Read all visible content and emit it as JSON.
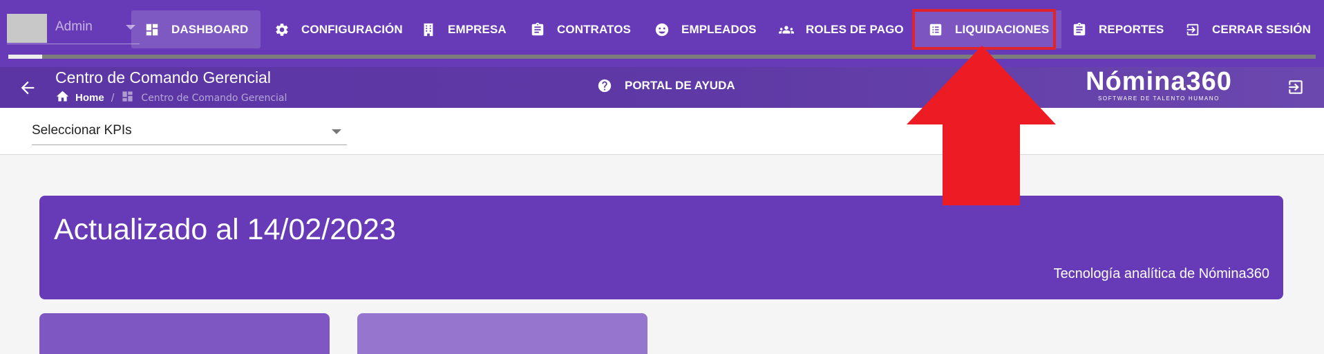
{
  "user": {
    "name": "Admin"
  },
  "nav": {
    "items": [
      {
        "label": "DASHBOARD",
        "icon": "dashboard-icon"
      },
      {
        "label": "CONFIGURACIÓN",
        "icon": "gear-icon"
      },
      {
        "label": "EMPRESA",
        "icon": "building-icon"
      },
      {
        "label": "CONTRATOS",
        "icon": "clipboard-icon"
      },
      {
        "label": "EMPLEADOS",
        "icon": "face-icon"
      },
      {
        "label": "ROLES DE PAGO",
        "icon": "group-icon"
      },
      {
        "label": "LIQUIDACIONES",
        "icon": "list-icon"
      },
      {
        "label": "REPORTES",
        "icon": "clipboard-icon"
      },
      {
        "label": "CERRAR SESIÓN",
        "icon": "logout-icon"
      }
    ],
    "active": "DASHBOARD",
    "highlighted": "LIQUIDACIONES"
  },
  "progress": {
    "fraction": 0.026
  },
  "header": {
    "title": "Centro de Comando Gerencial",
    "breadcrumb": {
      "home": "Home",
      "current": "Centro de Comando Gerencial"
    },
    "help_label": "PORTAL DE AYUDA"
  },
  "brand": {
    "name": "Nómina360",
    "tagline": "SOFTWARE DE TALENTO HUMANO"
  },
  "kpi": {
    "placeholder": "Seleccionar KPIs"
  },
  "banner": {
    "title": "Actualizado al 14/02/2023",
    "subtitle": "Tecnología analítica de Nómina360"
  },
  "colors": {
    "primary": "#673ab7",
    "annotation": "#ed1c24",
    "card_1": "#7e57c2",
    "card_2": "#9575cd"
  }
}
